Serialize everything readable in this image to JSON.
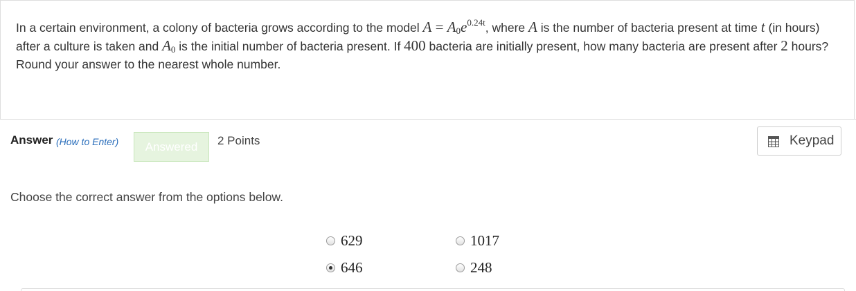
{
  "question": {
    "intro": "In a certain environment, a colony of bacteria grows according to the model ",
    "formula": {
      "lhs": "A",
      "equals": "=",
      "base": "A",
      "base_sub": "0",
      "exp_base": "e",
      "exponent": "0.24t"
    },
    "after_formula": ", where ",
    "var_a": "A",
    "mid1": " is the number of bacteria present at time ",
    "var_t": "t",
    "mid2": " (in hours) after a culture is taken and ",
    "a0": "A",
    "a0_sub": "0",
    "mid3": " is the initial number of bacteria present. If ",
    "initial_value": "400",
    "mid4": " bacteria are initially present, how many bacteria are present after ",
    "hours_value": "2",
    "end": " hours? Round your answer to the nearest whole number."
  },
  "answer_header": {
    "label": "Answer",
    "how_to_enter": "(How to Enter)",
    "status_badge": "Answered",
    "points": "2 Points",
    "keypad_label": "Keypad"
  },
  "instructions": "Choose the correct answer from the options below.",
  "options": [
    {
      "label": "629",
      "selected": false
    },
    {
      "label": "1017",
      "selected": false
    },
    {
      "label": "646",
      "selected": true
    },
    {
      "label": "248",
      "selected": false
    }
  ],
  "colors": {
    "link": "#2a6ebb",
    "badge_bg": "#e6f4df",
    "border": "#dddddd"
  },
  "icons": {
    "keypad": "keypad-grid-icon"
  }
}
